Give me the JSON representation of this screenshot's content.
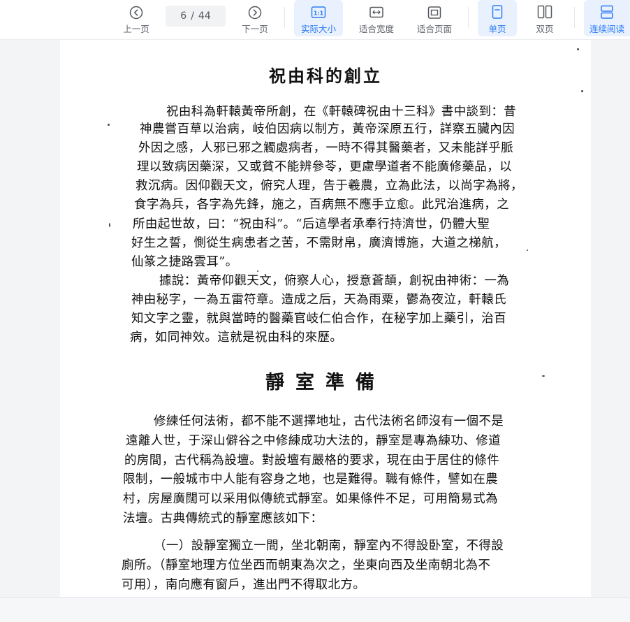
{
  "toolbar": {
    "prev_label": "上一页",
    "next_label": "下一页",
    "page_current": "6",
    "page_separator": "/",
    "page_total": "44",
    "actual_size_label": "实际大小",
    "fit_width_label": "适合宽度",
    "fit_page_label": "适合页面",
    "single_page_label": "单页",
    "double_page_label": "双页",
    "continuous_label": "连续阅读",
    "accent_color": "#2d7cf6"
  },
  "document": {
    "title1": "祝由科的創立",
    "section1_lines": [
      "祝由科為軒轅黃帝所創，在《軒轅碑祝由十三科》書中談到：昔",
      "神農嘗百草以治病，岐伯因病以制方，黃帝深原五行，詳察五臟內因",
      "外因之感，人邪已邪之觸處病者，一時不得其醫藥者，又未能詳乎脈",
      "理以致病因藥深，又或貧不能辨參苓，更慮學道者不能廣修藥品，以",
      "救沉病。因仰觀天文，俯究人理，告于羲農，立為此法，以尚字為將，",
      "食字為兵，各字為先鋒，施之，百病無不應手立愈。此咒治進病，之",
      "所由起世故，曰：“祝由科”。“后這學者承奉行持濟世，仍體大聖",
      "好生之誓，惻從生病患者之苦，不需財帛，廣濟博施，大道之梯航，",
      "仙篆之捷路雲耳”。",
      "據說：黃帝仰觀天文，俯察人心，授意蒼頡，創祝由神術：一為",
      "神由秘字，一為五雷符章。造成之后，天為雨粟，鬱為夜泣，軒轅氏",
      "知文字之靈，就與當時的醫藥官岐仁伯合作，在秘字加上藥引，治百",
      "病，如同神效。這就是祝由科的來歷。"
    ],
    "title2": "靜室準備",
    "section2_lines": [
      "修練任何法術，都不能不選擇地址，古代法術名師沒有一個不是",
      "遠離人世，于深山僻谷之中修練成功大法的，靜室是專為練功、修道",
      "的房間，古代稱為設壇。對設壇有嚴格的要求，現在由于居住的條件",
      "限制，一般城市中人能有容身之地，也是難得。職有條件，譬如在農",
      "村，房屋廣闊可以采用似傳統式靜室。如果條件不足，可用簡易式為",
      "法壇。古典傳統式的靜室應該如下：",
      "（一）設靜室獨立一間，坐北朝南，靜室內不得設卧室，不得設",
      "廁所。（靜室地理方位坐西而朝東為次之，坐東向西及坐南朝北為不",
      "可用），南向應有窗戶，進出門不得取北方。"
    ]
  }
}
